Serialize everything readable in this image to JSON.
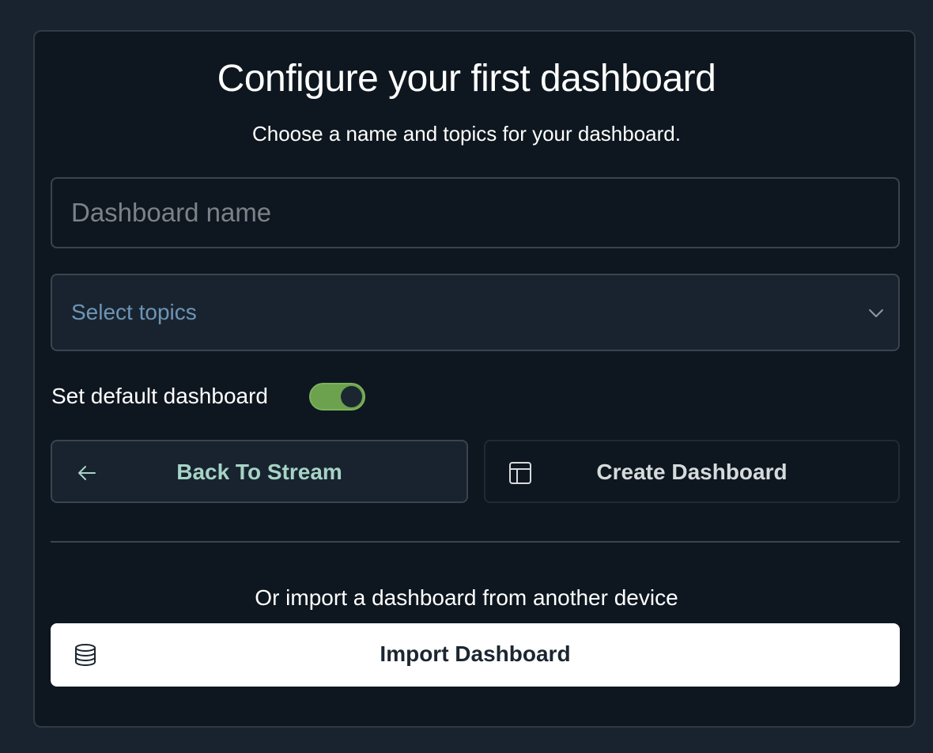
{
  "card": {
    "title": "Configure your first dashboard",
    "subtitle": "Choose a name and topics for your dashboard."
  },
  "form": {
    "name_placeholder": "Dashboard name",
    "name_value": "",
    "topics_placeholder": "Select topics",
    "default_label": "Set default dashboard",
    "default_enabled": true
  },
  "actions": {
    "back_label": "Back To Stream",
    "create_label": "Create Dashboard"
  },
  "import": {
    "prompt": "Or import a dashboard from another device",
    "button_label": "Import Dashboard"
  },
  "colors": {
    "background": "#19232f",
    "card": "#0e171f",
    "toggle_on": "#6ca14e",
    "topics_text": "#6d95b5",
    "back_text": "#a6d4c6"
  },
  "icons": {
    "topics_chevron": "chevron-down-icon",
    "back": "arrow-left-icon",
    "create": "layout-icon",
    "import": "database-icon"
  }
}
